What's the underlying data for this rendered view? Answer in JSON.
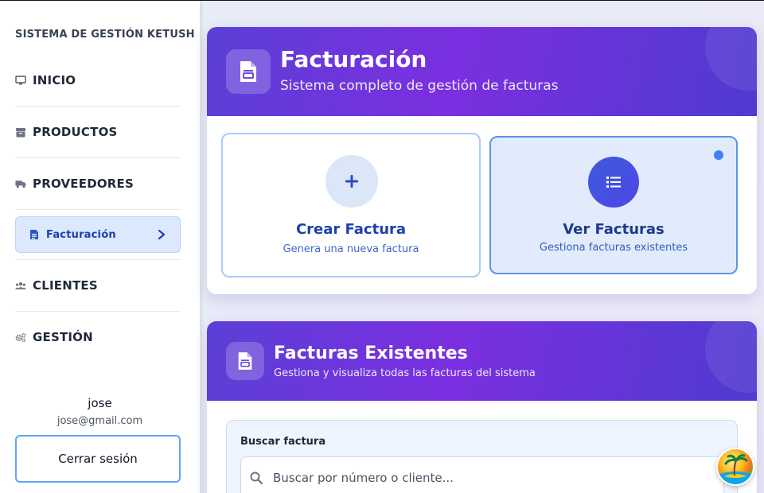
{
  "sidebar": {
    "brand": "SISTEMA DE GESTIÓN KETUSH",
    "items": [
      {
        "label": "INICIO",
        "icon": "monitor-icon"
      },
      {
        "label": "PRODUCTOS",
        "icon": "box-icon"
      },
      {
        "label": "PROVEEDORES",
        "icon": "truck-icon"
      },
      {
        "label": "Facturación",
        "icon": "document-icon",
        "active": true
      },
      {
        "label": "CLIENTES",
        "icon": "users-icon"
      },
      {
        "label": "GESTIÓN",
        "icon": "gears-icon"
      }
    ],
    "user": {
      "name": "jose",
      "email": "jose@gmail.com"
    },
    "logout_label": "Cerrar sesión"
  },
  "billing_card": {
    "title": "Facturación",
    "subtitle": "Sistema completo de gestión de facturas",
    "actions": [
      {
        "title": "Crear Factura",
        "subtitle": "Genera una nueva factura",
        "icon": "plus-icon"
      },
      {
        "title": "Ver Facturas",
        "subtitle": "Gestiona facturas existentes",
        "icon": "list-icon",
        "selected": true
      }
    ]
  },
  "invoices_card": {
    "title": "Facturas Existentes",
    "subtitle": "Gestiona y visualiza todas las facturas del sistema",
    "search": {
      "label": "Buscar factura",
      "placeholder": "Buscar por número o cliente..."
    }
  },
  "colors": {
    "accent": "#5b3fd6",
    "accent_2": "#7b2fe0",
    "active_nav_bg": "#dbe8fd",
    "link_blue": "#1e40af"
  }
}
